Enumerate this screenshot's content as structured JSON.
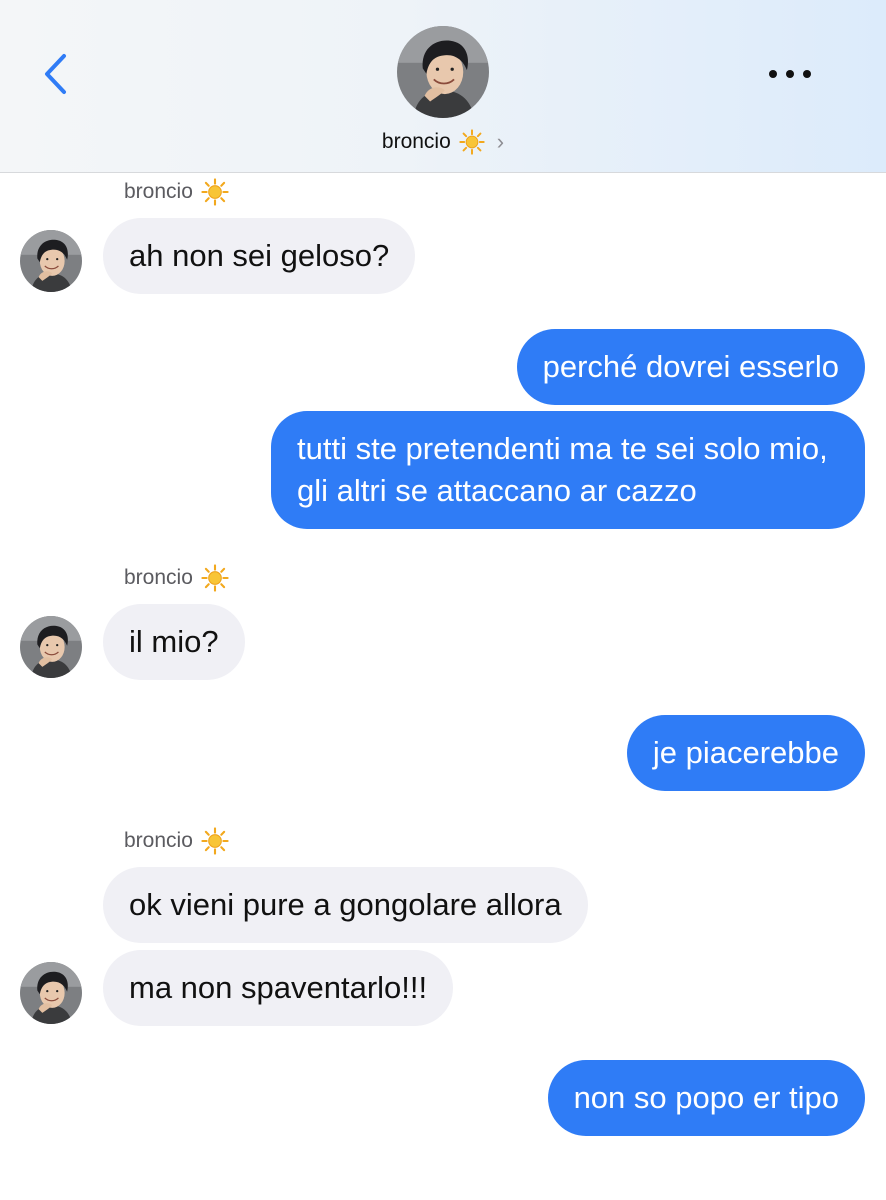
{
  "header": {
    "contact_name": "broncio",
    "back_icon": "chevron-left-icon",
    "more_icon": "more-horizontal-icon",
    "status_emoji": "sun-icon",
    "accent_color": "#2f7cf6"
  },
  "messages": [
    {
      "id": "m1",
      "direction": "incoming",
      "sender": "broncio",
      "text": "ah non sei geloso?"
    },
    {
      "id": "m2",
      "direction": "outgoing",
      "text": "perché dovrei esserlo"
    },
    {
      "id": "m3",
      "direction": "outgoing",
      "text": "tutti ste pretendenti ma te sei solo mio, gli altri se attaccano ar cazzo"
    },
    {
      "id": "m4",
      "direction": "incoming",
      "sender": "broncio",
      "text": "il mio?"
    },
    {
      "id": "m5",
      "direction": "outgoing",
      "text": "je piacerebbe"
    },
    {
      "id": "m6",
      "direction": "incoming",
      "sender": "broncio",
      "text": "ok vieni pure a gongolare allora"
    },
    {
      "id": "m7",
      "direction": "incoming",
      "text": "ma non spaventarlo!!!"
    },
    {
      "id": "m8",
      "direction": "outgoing",
      "text": "non so popo er tipo"
    }
  ],
  "colors": {
    "outgoing_bubble": "#2f7cf6",
    "incoming_bubble": "#f0f0f5"
  }
}
